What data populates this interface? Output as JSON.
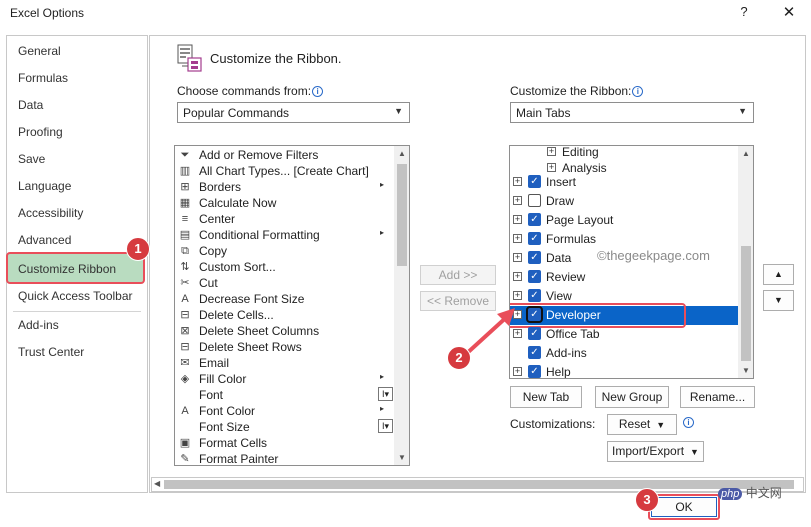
{
  "window": {
    "title": "Excel Options",
    "help": "?",
    "close": "✕"
  },
  "sidebar": {
    "items": [
      "General",
      "Formulas",
      "Data",
      "Proofing",
      "Save",
      "Language",
      "Accessibility",
      "Advanced",
      "Customize Ribbon",
      "Quick Access Toolbar",
      "Add-ins",
      "Trust Center"
    ],
    "selected": "Customize Ribbon"
  },
  "header": {
    "title": "Customize the Ribbon."
  },
  "left_pane": {
    "label": "Choose commands from:",
    "combo_value": "Popular Commands",
    "commands": [
      {
        "label": "Add or Remove Filters",
        "icon": "funnel-icon"
      },
      {
        "label": "All Chart Types... [Create Chart]",
        "icon": "chart-icon"
      },
      {
        "label": "Borders",
        "icon": "borders-icon",
        "sub": "▸"
      },
      {
        "label": "Calculate Now",
        "icon": "calculator-icon"
      },
      {
        "label": "Center",
        "icon": "align-center-icon"
      },
      {
        "label": "Conditional Formatting",
        "icon": "conditional-format-icon",
        "sub": "▸"
      },
      {
        "label": "Copy",
        "icon": "copy-icon"
      },
      {
        "label": "Custom Sort...",
        "icon": "sort-icon"
      },
      {
        "label": "Cut",
        "icon": "scissors-icon"
      },
      {
        "label": "Decrease Font Size",
        "icon": "decrease-font-icon"
      },
      {
        "label": "Delete Cells...",
        "icon": "delete-cells-icon"
      },
      {
        "label": "Delete Sheet Columns",
        "icon": "delete-columns-icon"
      },
      {
        "label": "Delete Sheet Rows",
        "icon": "delete-rows-icon"
      },
      {
        "label": "Email",
        "icon": "email-icon"
      },
      {
        "label": "Fill Color",
        "icon": "fill-color-icon",
        "sub": "▸"
      },
      {
        "label": "Font",
        "icon": "font-icon",
        "box": "I▾"
      },
      {
        "label": "Font Color",
        "icon": "font-color-icon",
        "sub": "▸"
      },
      {
        "label": "Font Size",
        "icon": "font-size-icon",
        "box": "I▾"
      },
      {
        "label": "Format Cells",
        "icon": "format-cells-icon"
      },
      {
        "label": "Format Painter",
        "icon": "format-painter-icon"
      }
    ]
  },
  "middle": {
    "add": "Add >>",
    "remove": "<< Remove"
  },
  "right_pane": {
    "label": "Customize the Ribbon:",
    "combo_value": "Main Tabs",
    "tabs": [
      {
        "label": "Editing",
        "level": 2,
        "checkbox": false
      },
      {
        "label": "Analysis",
        "level": 2,
        "checkbox": false
      },
      {
        "label": "Insert",
        "level": 1,
        "checked": true
      },
      {
        "label": "Draw",
        "level": 1,
        "checked": false
      },
      {
        "label": "Page Layout",
        "level": 1,
        "checked": true
      },
      {
        "label": "Formulas",
        "level": 1,
        "checked": true
      },
      {
        "label": "Data",
        "level": 1,
        "checked": true
      },
      {
        "label": "Review",
        "level": 1,
        "checked": true
      },
      {
        "label": "View",
        "level": 1,
        "checked": true
      },
      {
        "label": "Developer",
        "level": 1,
        "checked": true,
        "selected": true
      },
      {
        "label": "Office Tab",
        "level": 1,
        "checked": true
      },
      {
        "label": "Add-ins",
        "level": 1,
        "checked": true,
        "no_expander": true
      },
      {
        "label": "Help",
        "level": 1,
        "checked": true
      }
    ],
    "buttons": {
      "new_tab": "New Tab",
      "new_group": "New Group",
      "rename": "Rename..."
    },
    "customizations_label": "Customizations:",
    "reset": "Reset",
    "import_export": "Import/Export"
  },
  "footer": {
    "ok": "OK"
  },
  "annotations": {
    "badge1": "1",
    "badge2": "2",
    "badge3": "3"
  },
  "watermark": "©thegeekpage.com",
  "php_watermark": {
    "badge": "php",
    "text": "中文网"
  },
  "colors": {
    "selection": "#0a64c8",
    "highlight_green": "#b9dcc0",
    "annotation_red": "#e94e5a"
  }
}
